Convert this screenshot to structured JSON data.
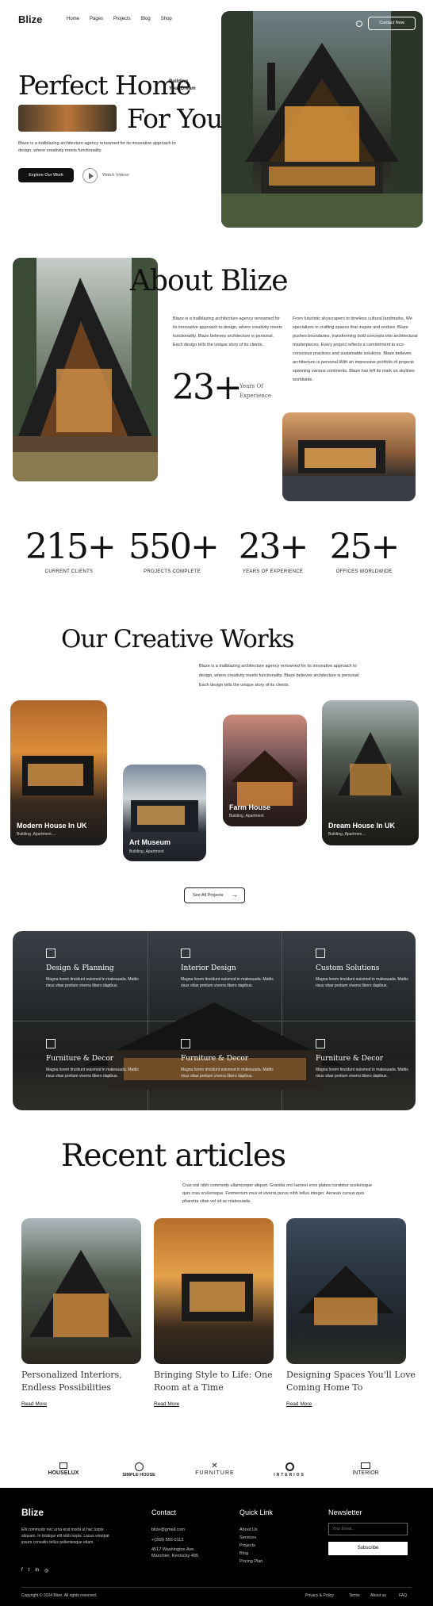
{
  "nav": {
    "logo": "Blize",
    "items": [
      "Home",
      "Pages",
      "Projects",
      "Blog",
      "Shop"
    ],
    "contact": "Contact Now"
  },
  "hero": {
    "title1": "Perfect Home",
    "title2": "For You",
    "aside": "Building\nYour Dream",
    "desc": "Blaze is a trailblazing architecture agency renowned for its innovative approach to design, where creativity meets functionality.",
    "cta": "Explore Our Work",
    "watch": "Watch Videos"
  },
  "about": {
    "title": "About Blize",
    "p1": "Blaze is a trailblazing architecture agency renowned for its innovative approach to design, where creativity meets functionality. Blaze believes architecture is personal. Each design tells the unique story of its clients.",
    "p2": "From futuristic skyscrapers to timeless cultural landmarks, We specializes in crafting spaces that inspire and endure. Blaze pushes boundaries, transforming bold concepts into architectural masterpieces. Every project reflects a commitment to eco-conscious practices and sustainable solutions. Blaze believes architecture is personal.With an impressive portfolio of projects spanning various continents, Blaze has left its mark on skylines worldwide.",
    "num": "23+",
    "num_lbl": "Years Of\nExperience"
  },
  "stats": [
    {
      "num": "215+",
      "label": "CURRENT CLIENTS"
    },
    {
      "num": "550+",
      "label": "PROJECTS COMPLETE"
    },
    {
      "num": "23+",
      "label": "YEARS OF EXPERIENCE"
    },
    {
      "num": "25+",
      "label": "OFFICES WORLDWIDE"
    }
  ],
  "works": {
    "title": "Our Creative Works",
    "desc": "Blaze is a trailblazing architecture agency renowned for its innovative approach to design, where creativity meets functionality. Blaze believes architecture is personal. Each design tells the unique story of its clients.",
    "cards": [
      {
        "title": "Modern House In UK",
        "sub": "Building ,Apartment...."
      },
      {
        "title": "Art Museum",
        "sub": "Building ,Apartment"
      },
      {
        "title": "Farm House",
        "sub": "Building ,Apartment"
      },
      {
        "title": "Dream House In UK",
        "sub": "Building ,Apartmen...."
      }
    ],
    "btn": "See All Projects"
  },
  "services": [
    {
      "title": "Design & Planning",
      "text": "Magna lorem tincidunt euismod in malesuada. Mattis risus vitae pretium viverra libero dapibus."
    },
    {
      "title": "Interior Design",
      "text": "Magna lorem tincidunt euismod in malesuada. Mattis risus vitae pretium viverra libero dapibus."
    },
    {
      "title": "Custom Solutions",
      "text": "Magna lorem tincidunt euismod in malesuada. Mattis risus vitae pretium viverra libero dapibus."
    },
    {
      "title": "Furniture & Decor",
      "text": "Magna lorem tincidunt euismod in malesuada. Mattis risus vitae pretium viverra libero dapibus."
    },
    {
      "title": "Furniture & Decor",
      "text": "Magna lorem tincidunt euismod in malesuada. Mattis risus vitae pretium viverra libero dapibus."
    },
    {
      "title": "Furniture & Decor",
      "text": "Magna lorem tincidunt euismod in malesuada. Mattis risus vitae pretium viverra libero dapibus."
    }
  ],
  "articles": {
    "title": "Recent articles",
    "desc": "Cras nisl nibh commodo ullamcorper aliquet. Gravida orci laoreet eros platea curabitur scelerisque quis cras scelerisque. Fermentum mus et viverra purus nibh tellus integer. Aenean cursus quis pharetra vitae vel sit ac malesuada.",
    "items": [
      {
        "title": "Personalized Interiors, Endless Possibilities",
        "link": "Read More"
      },
      {
        "title": "Bringing Style to Life: One Room at a Time",
        "link": "Read More"
      },
      {
        "title": "Designing Spaces You'll Love Coming Home To",
        "link": "Read More"
      }
    ]
  },
  "brands": [
    "HOUSELUX",
    "SIMPLE HOUSE",
    "FURNITURE",
    "INTERIOS",
    "INTERIOR"
  ],
  "footer": {
    "logo": "Blize",
    "about": "Elit commodo nec urna erat morbi at hac turpis aliquam. In tristique elit nibh turpis. Lacus volutpat ipsum convallis tellus pellentesque etiam.",
    "contact_h": "Contact",
    "email": "blize@gmail.com",
    "phone": "+(208) 555-0112",
    "addr": "4517 Washington Ave.\nManchter, Kentucky 495",
    "quick_h": "Quick Link",
    "links": [
      "About Us",
      "Services",
      "Projects",
      "Blog",
      "Pricing Plan"
    ],
    "news_h": "Newsletter",
    "placeholder": "Your Email...",
    "subscribe": "Subscribe",
    "copy": "Copyright © 2024 Blize. All rights reserved.",
    "bottom": [
      "Privacy & Policy",
      "Terms",
      "About us",
      "FAQ"
    ]
  }
}
